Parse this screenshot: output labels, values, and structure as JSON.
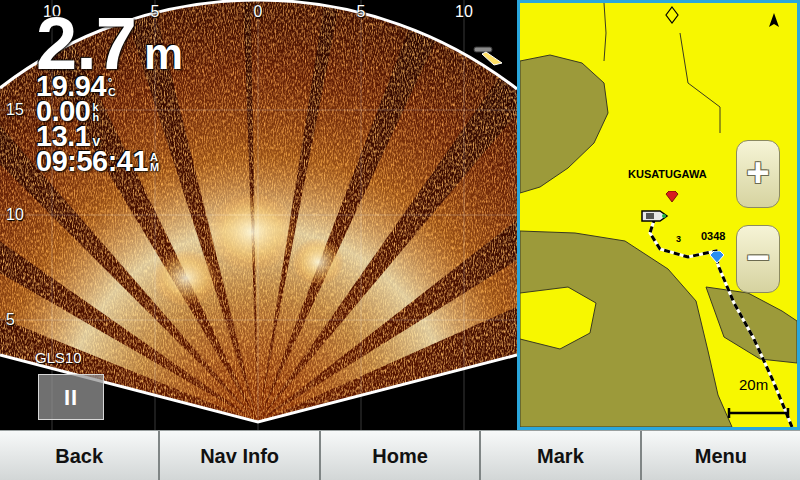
{
  "sonar": {
    "source": "GLS10",
    "pause_button": {
      "label": "II"
    },
    "range_scale": [
      "10",
      "5",
      "0",
      "5",
      "10"
    ],
    "depth_scale": [
      "15",
      "10",
      "5"
    ],
    "readouts": [
      {
        "kind": "depth",
        "value": "2.7",
        "unit": [
          "m"
        ]
      },
      {
        "kind": "temperature",
        "value": "19.94",
        "unit": [
          "°",
          "C"
        ]
      },
      {
        "kind": "speed",
        "value": "0.00",
        "unit": [
          "k",
          "h"
        ]
      },
      {
        "kind": "voltage",
        "value": "13.1",
        "unit": [
          "v"
        ]
      },
      {
        "kind": "time",
        "value": "09:56:41",
        "unit": [
          "A",
          "M"
        ]
      }
    ]
  },
  "map": {
    "places": [
      {
        "label": "KUSATUGAWA",
        "color": "#d81e1e"
      },
      {
        "label": "0348",
        "color": "#2a8ef0"
      }
    ],
    "track_marker": "3",
    "zoom_in": "+",
    "zoom_out": "−",
    "scale": "20m"
  },
  "softkeys": [
    "Back",
    "Nav Info",
    "Home",
    "Mark",
    "Menu"
  ]
}
